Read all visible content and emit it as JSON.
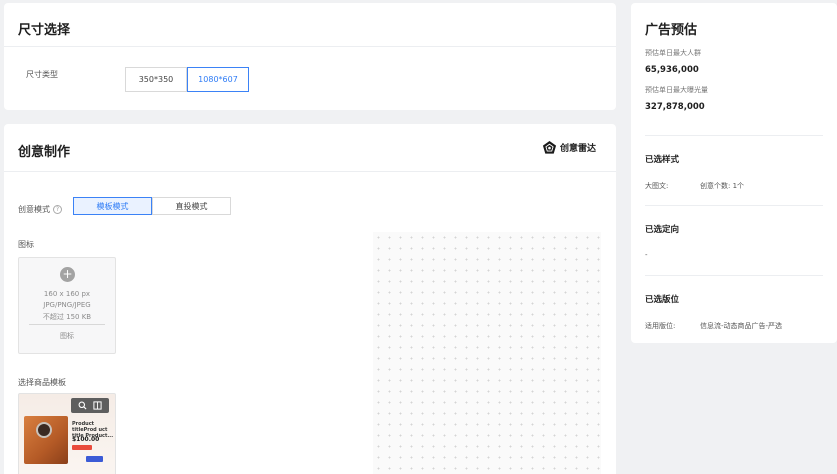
{
  "size_section": {
    "title": "尺寸选择",
    "type_label": "尺寸类型",
    "options": [
      "350*350",
      "1080*607"
    ],
    "selected": "1080*607"
  },
  "creative_section": {
    "title": "创意制作",
    "radar_label": "创意雷达",
    "mode_label": "创意模式",
    "mode_options": [
      "模板模式",
      "直投模式"
    ],
    "mode_selected": "模板模式",
    "icon_label": "图标",
    "upload": {
      "size": "160 x 160 px",
      "formats": "JPG/PNG/JPEG",
      "limit": "不超过 150 KB",
      "caption": "图标"
    },
    "template_label": "选择商品模板",
    "template_card": {
      "product_title": "Product titleProd uct title Product...",
      "price": "$100.00"
    }
  },
  "estimate": {
    "title": "广告预估",
    "audience_label": "预估单日最大人群",
    "audience_value": "65,936,000",
    "exposure_label": "预估单日最大曝光量",
    "exposure_value": "327,878,000",
    "style_title": "已选样式",
    "style_name": "大图文:",
    "style_count": "创意个数: 1个",
    "targeting_title": "已选定向",
    "targeting_value": "-",
    "placement_title": "已选版位",
    "placement_label": "适用版位:",
    "placement_value": "信息流-动态商品广告-严选"
  },
  "colors": {
    "accent": "#2f7cf6",
    "accent_bg": "#eaf2ff",
    "page_bg": "#f0f1f3"
  }
}
